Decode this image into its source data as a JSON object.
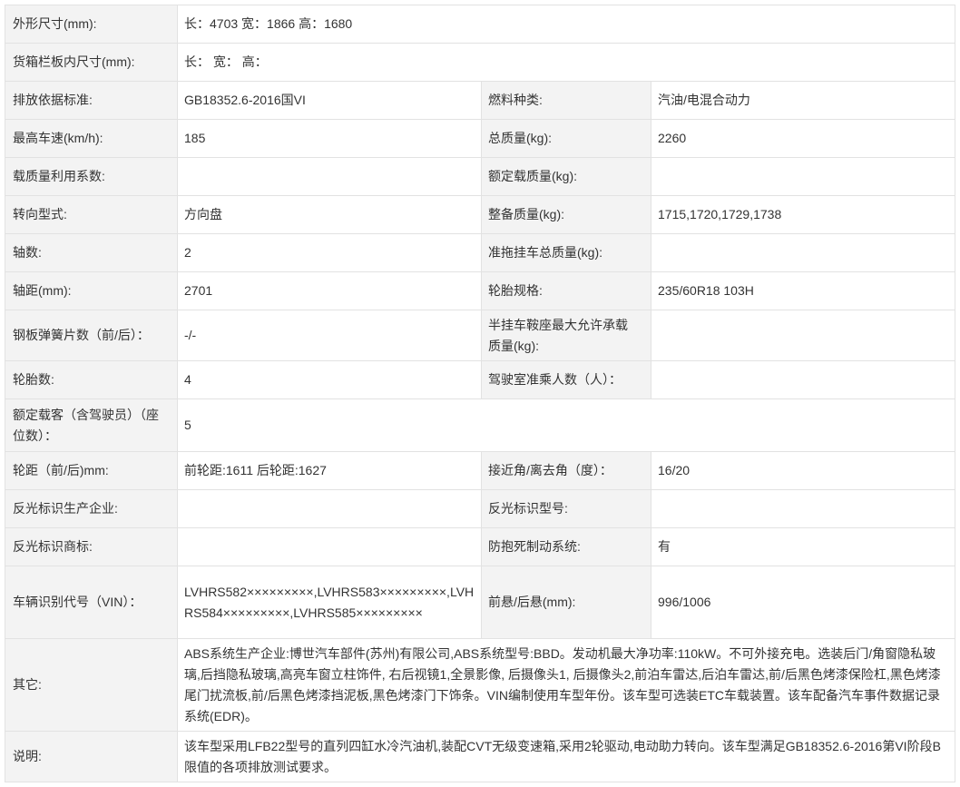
{
  "colors": {
    "label_bg": "#f3f3f3",
    "value_bg": "#ffffff",
    "border": "#e2e2e2",
    "text": "#333333"
  },
  "rows": [
    {
      "label": "外形尺寸(mm):",
      "value": "长：4703 宽：1866 高：1680"
    },
    {
      "label": "货箱栏板内尺寸(mm):",
      "value": "长： 宽： 高："
    },
    {
      "label": "排放依据标准:",
      "value": "GB18352.6-2016国VI",
      "label2": "燃料种类:",
      "value2": "汽油/电混合动力"
    },
    {
      "label": "最高车速(km/h):",
      "value": "185",
      "label2": "总质量(kg):",
      "value2": "2260"
    },
    {
      "label": "载质量利用系数:",
      "value": "",
      "label2": "额定载质量(kg):",
      "value2": ""
    },
    {
      "label": "转向型式:",
      "value": "方向盘",
      "label2": "整备质量(kg):",
      "value2": "1715,1720,1729,1738"
    },
    {
      "label": "轴数:",
      "value": "2",
      "label2": "准拖挂车总质量(kg):",
      "value2": ""
    },
    {
      "label": "轴距(mm):",
      "value": "2701",
      "label2": "轮胎规格:",
      "value2": "235/60R18 103H"
    },
    {
      "label": "钢板弹簧片数（前/后）：",
      "value": "-/-",
      "label2": "半挂车鞍座最大允许承载质量(kg):",
      "value2": ""
    },
    {
      "label": "轮胎数:",
      "value": "4",
      "label2": "驾驶室准乘人数（人）：",
      "value2": ""
    },
    {
      "label": "额定载客（含驾驶员）（座位数）：",
      "value": "5"
    },
    {
      "label": "轮距（前/后)mm:",
      "value": "前轮距:1611 后轮距:1627",
      "label2": "接近角/离去角（度）：",
      "value2": "16/20"
    },
    {
      "label": "反光标识生产企业:",
      "value": "",
      "label2": "反光标识型号:",
      "value2": ""
    },
    {
      "label": "反光标识商标:",
      "value": "",
      "label2": "防抱死制动系统:",
      "value2": "有"
    },
    {
      "label": "车辆识别代号（VIN）：",
      "value": "LVHRS582×××××××××,LVHRS583×××××××××,LVHRS584×××××××××,LVHRS585×××××××××",
      "label2": "前悬/后悬(mm):",
      "value2": "996/1006"
    },
    {
      "label": "其它:",
      "value": "ABS系统生产企业:博世汽车部件(苏州)有限公司,ABS系统型号:BBD。发动机最大净功率:110kW。不可外接充电。选装后门/角窗隐私玻璃,后挡隐私玻璃,高亮车窗立柱饰件, 右后视镜1,全景影像, 后摄像头1, 后摄像头2,前泊车雷达,后泊车雷达,前/后黑色烤漆保险杠,黑色烤漆尾门扰流板,前/后黑色烤漆挡泥板,黑色烤漆门下饰条。VIN编制使用车型年份。该车型可选装ETC车载装置。该车配备汽车事件数据记录系统(EDR)。"
    },
    {
      "label": "说明:",
      "value": "该车型采用LFB22型号的直列四缸水冷汽油机,装配CVT无级变速箱,采用2轮驱动,电动助力转向。该车型满足GB18352.6-2016第VI阶段B限值的各项排放测试要求。"
    }
  ]
}
